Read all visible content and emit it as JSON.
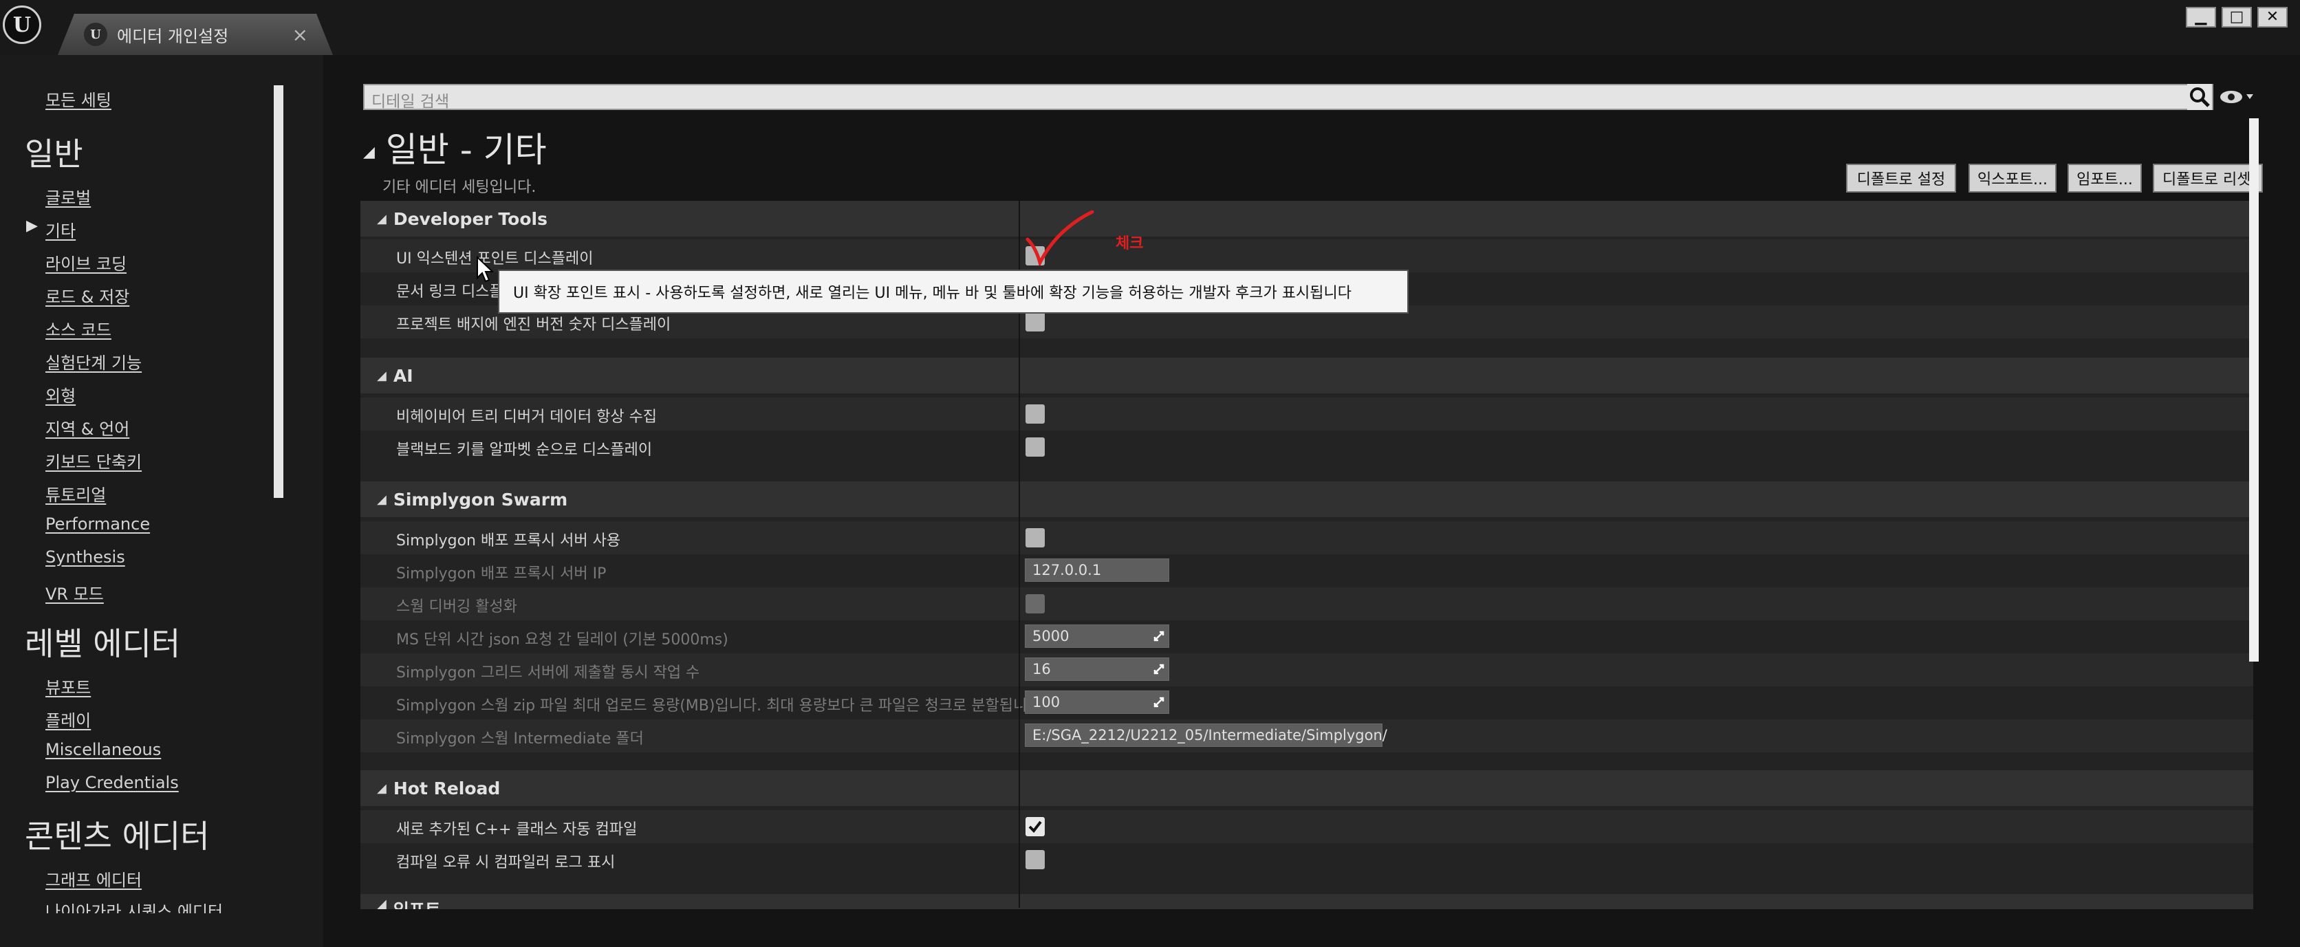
{
  "window": {
    "logo_text": "U",
    "tab_title": "에디터 개인설정",
    "tab_icon_text": "U",
    "tab_close": "×",
    "minimize": "▁",
    "maximize": "□",
    "close": "✕"
  },
  "sidebar": {
    "all_settings": "모든 세팅",
    "groups": [
      {
        "title": "일반",
        "items": [
          "글로벌",
          "기타",
          "라이브 코딩",
          "로드 & 저장",
          "소스 코드",
          "실험단계 기능",
          "외형",
          "지역 & 언어",
          "키보드 단축키",
          "튜토리얼",
          "Performance",
          "Synthesis",
          "VR 모드"
        ]
      },
      {
        "title": "레벨 에디터",
        "items": [
          "뷰포트",
          "플레이",
          "Miscellaneous",
          "Play Credentials"
        ]
      },
      {
        "title": "콘텐츠 에디터",
        "items": [
          "그래프 에디터",
          "나이아가라 시퀀스 에디터"
        ]
      }
    ],
    "selected_item": "기타",
    "selected_marker": "▶"
  },
  "search": {
    "placeholder": "디테일 검색"
  },
  "section": {
    "title": "일반 - 기타",
    "subtitle": "기타 에디터 세팅입니다.",
    "buttons": [
      "디폴트로 설정",
      "익스포트...",
      "임포트...",
      "디폴트로 리셋"
    ]
  },
  "categories": {
    "developer_tools": {
      "title": "Developer Tools",
      "rows": [
        "UI 익스텐션 포인트 디스플레이",
        "문서 링크 디스플레이",
        "프로젝트 배지에 엔진 버전 숫자 디스플레이"
      ]
    },
    "ai": {
      "title": "AI",
      "rows": [
        "비헤이비어 트리 디버거 데이터 항상 수집",
        "블랙보드 키를 알파벳 순으로 디스플레이"
      ]
    },
    "simplygon": {
      "title": "Simplygon Swarm",
      "rows": [
        "Simplygon 배포 프록시 서버 사용",
        "Simplygon 배포 프록시 서버 IP",
        "스웜 디버깅 활성화",
        "MS 단위 시간 json 요청 간 딜레이 (기본 5000ms)",
        "Simplygon 그리드 서버에 제출할 동시 작업 수",
        "Simplygon 스웜 zip 파일 최대 업로드 용량(MB)입니다. 최대 용량보다 큰 파일은 청크로 분할됩니다",
        "Simplygon 스웜 Intermediate 폴더"
      ],
      "values": {
        "server_ip": "127.0.0.1",
        "delay": "5000",
        "jobs": "16",
        "upload_mb": "100",
        "intermediate_folder": "E:/SGA_2212/U2212_05/Intermediate/Simplygon/"
      }
    },
    "hot_reload": {
      "title": "Hot Reload",
      "rows": [
        "새로 추가된 C++ 클래스 자동 컴파일",
        "컴파일 오류 시 컴파일러 로그 표시"
      ]
    },
    "next": {
      "title": "임포트"
    }
  },
  "tooltip": "UI 확장 포인트 표시 - 사용하도록 설정하면, 새로 열리는 UI 메뉴, 메뉴 바 및 툴바에 확장 기능을 허용하는 개발자 후크가 표시됩니다",
  "annotation": {
    "text": "체크",
    "color": "#e02020"
  },
  "colors": {
    "background": "#141414",
    "panel": "#232323",
    "category_header": "#313131",
    "tooltip_bg": "#f4f4f4"
  }
}
